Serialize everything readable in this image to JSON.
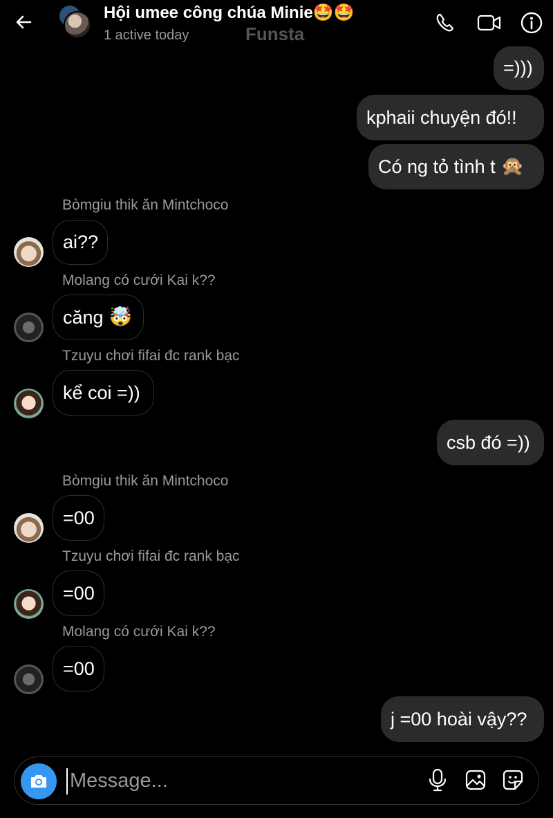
{
  "header": {
    "title": "Hội umee công chúa Minie",
    "title_emoji": "🤩🤩",
    "subtitle": "1 active today",
    "watermark": "Funsta",
    "icons": [
      "back-arrow-icon",
      "phone-icon",
      "video-icon",
      "info-icon"
    ]
  },
  "messages": [
    {
      "dir": "out",
      "text": "=)))"
    },
    {
      "dir": "out",
      "text": "kphaii chuyện đó!!"
    },
    {
      "dir": "out",
      "text": "Có ng tỏ tình t",
      "emoji": "🙊"
    },
    {
      "dir": "in",
      "sender": "Bòmgiu thik ăn Mintchoco",
      "text": "ai??"
    },
    {
      "dir": "in",
      "sender": "Molang có cưới Kai k??",
      "text": "căng",
      "emoji": "🤯"
    },
    {
      "dir": "in",
      "sender": "Tzuyu chơi fifai đc rank bạc",
      "text": "kể coi =))"
    },
    {
      "dir": "out",
      "text": "csb đó =))"
    },
    {
      "dir": "in",
      "sender": "Bòmgiu thik ăn Mintchoco",
      "text": "=00"
    },
    {
      "dir": "in",
      "sender": "Tzuyu chơi fifai đc rank bạc",
      "text": "=00"
    },
    {
      "dir": "in",
      "sender": "Molang có cưới Kai k??",
      "text": "=00"
    },
    {
      "dir": "out",
      "text": "j =00 hoài vậy??"
    }
  ],
  "composer": {
    "placeholder": "Message...",
    "icons": [
      "camera-icon",
      "microphone-icon",
      "gallery-icon",
      "sticker-icon"
    ]
  },
  "colors": {
    "background": "#000000",
    "outgoing_bubble": "#2b2b2b",
    "camera_button": "#3797f0",
    "secondary_text": "#9a9a9a"
  }
}
